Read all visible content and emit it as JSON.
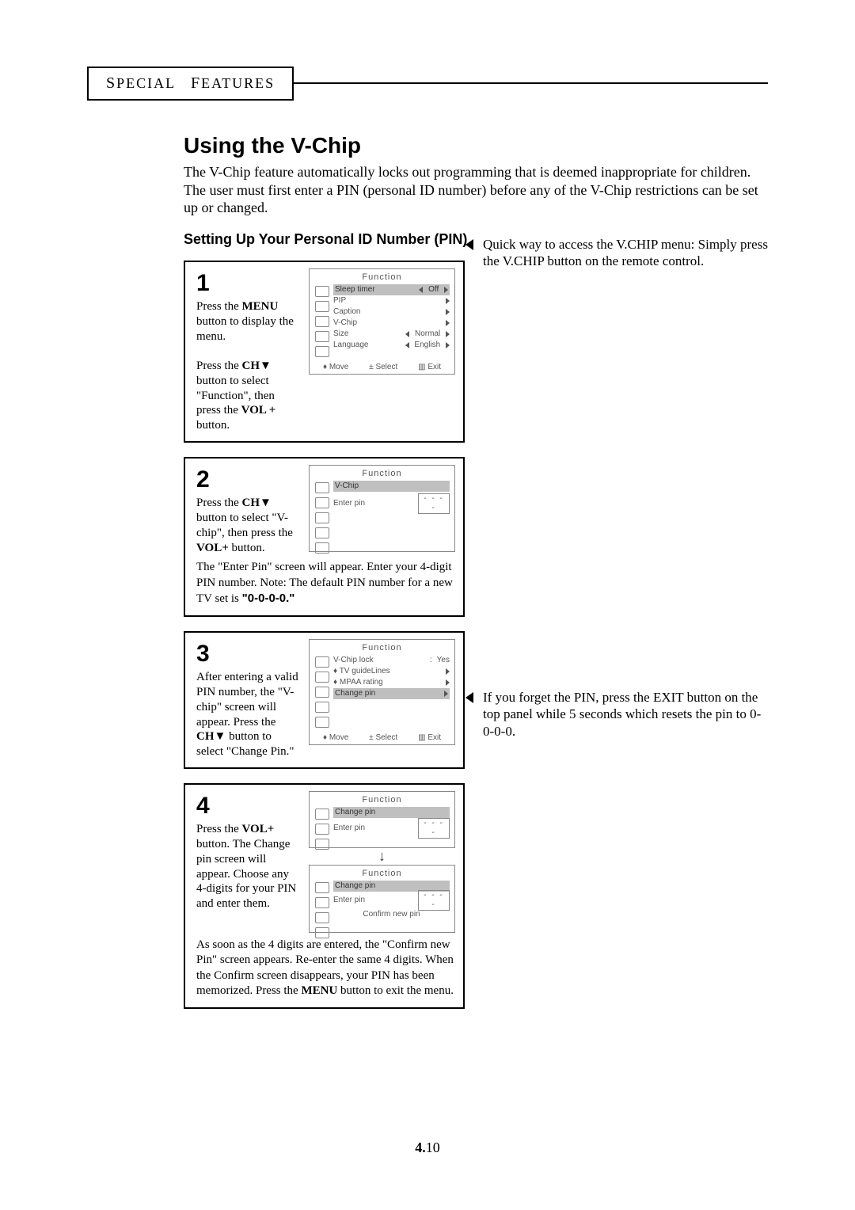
{
  "header": {
    "prefix": "S",
    "word1_rest": "PECIAL",
    "word2_cap": "F",
    "word2_rest": "EATURES"
  },
  "title": "Using the V-Chip",
  "intro": "The V-Chip feature automatically locks out programming that is deemed inappropriate for children. The user must first enter a PIN (personal ID number) before any of the V-Chip restrictions can be set up or changed.",
  "subheading": "Setting Up Your Personal ID Number (PIN)",
  "sidenote1": "Quick way to access the V.CHIP menu: Simply press the V.CHIP button on the remote control.",
  "sidenote2": "If you forget the PIN, press the EXIT button on the top panel while 5 seconds which resets the pin to 0-0-0-0.",
  "steps": {
    "s1": {
      "num": "1",
      "text_a": "Press the ",
      "menu": "MENU",
      "text_b": " button to display the menu.",
      "text_c": "Press the ",
      "ch": "CH▼",
      "text_d": " button to select \"Function\", then press the ",
      "vol": "VOL +",
      "text_e": " button."
    },
    "s2": {
      "num": "2",
      "text_a": "Press the ",
      "ch": "CH▼",
      "text_b": " button to select \"V-chip\", then press the ",
      "vol": "VOL+",
      "text_c": " button.",
      "note_a": "The \"Enter Pin\" screen will appear. Enter your 4-digit PIN number. Note: The default PIN number for a new TV set is ",
      "default_pin": "\"0-0-0-0.\""
    },
    "s3": {
      "num": "3",
      "text_a": "After entering a valid PIN number, the \"V-chip\" screen will appear. Press the ",
      "ch": "CH▼",
      "text_b": " button to select \"Change Pin.\""
    },
    "s4": {
      "num": "4",
      "text_a": "Press the ",
      "vol": "VOL+",
      "text_b": " button. The Change pin screen will appear. Choose any 4-digits for your PIN and enter them.",
      "note_a": "As soon as the 4 digits are entered, the \"Confirm new Pin\" screen appears. Re-enter the same 4 digits. When the Confirm screen disappears, your PIN has been memorized. Press the ",
      "menu": "MENU",
      "note_b": " button to exit the menu."
    }
  },
  "osd": {
    "title": "Function",
    "foot_move": "♦ Move",
    "foot_select": "± Select",
    "foot_exit": "▥ Exit",
    "s1": {
      "rows": [
        {
          "label": "Sleep timer",
          "val": "Off",
          "lr": true,
          "hl": true
        },
        {
          "label": "PIP",
          "val": "",
          "tri": true
        },
        {
          "label": "Caption",
          "val": "",
          "tri": true
        },
        {
          "label": "V-Chip",
          "val": "",
          "tri": true
        },
        {
          "label": "Size",
          "val": "Normal",
          "lr_r": true
        },
        {
          "label": "Language",
          "val": "English",
          "lr": true
        }
      ]
    },
    "s2": {
      "label": "V-Chip",
      "enter": "Enter pin",
      "dots": "- - - -"
    },
    "s3": {
      "rows": [
        {
          "label": "V-Chip lock",
          "val": "Yes",
          "colon": true
        },
        {
          "label": "♦ TV guideLines",
          "tri": true
        },
        {
          "label": "♦ MPAA rating",
          "tri": true
        },
        {
          "label": "Change pin",
          "tri": true,
          "hl": true
        }
      ]
    },
    "s4a": {
      "label": "Change pin",
      "enter": "Enter pin",
      "dots": "- - - -"
    },
    "s4b": {
      "label": "Change pin",
      "enter": "Enter pin",
      "dots": "- - - -",
      "confirm": "Confirm new pin"
    },
    "arrow_down": "↓"
  },
  "page_num": {
    "chapter": "4.",
    "num": "10"
  }
}
